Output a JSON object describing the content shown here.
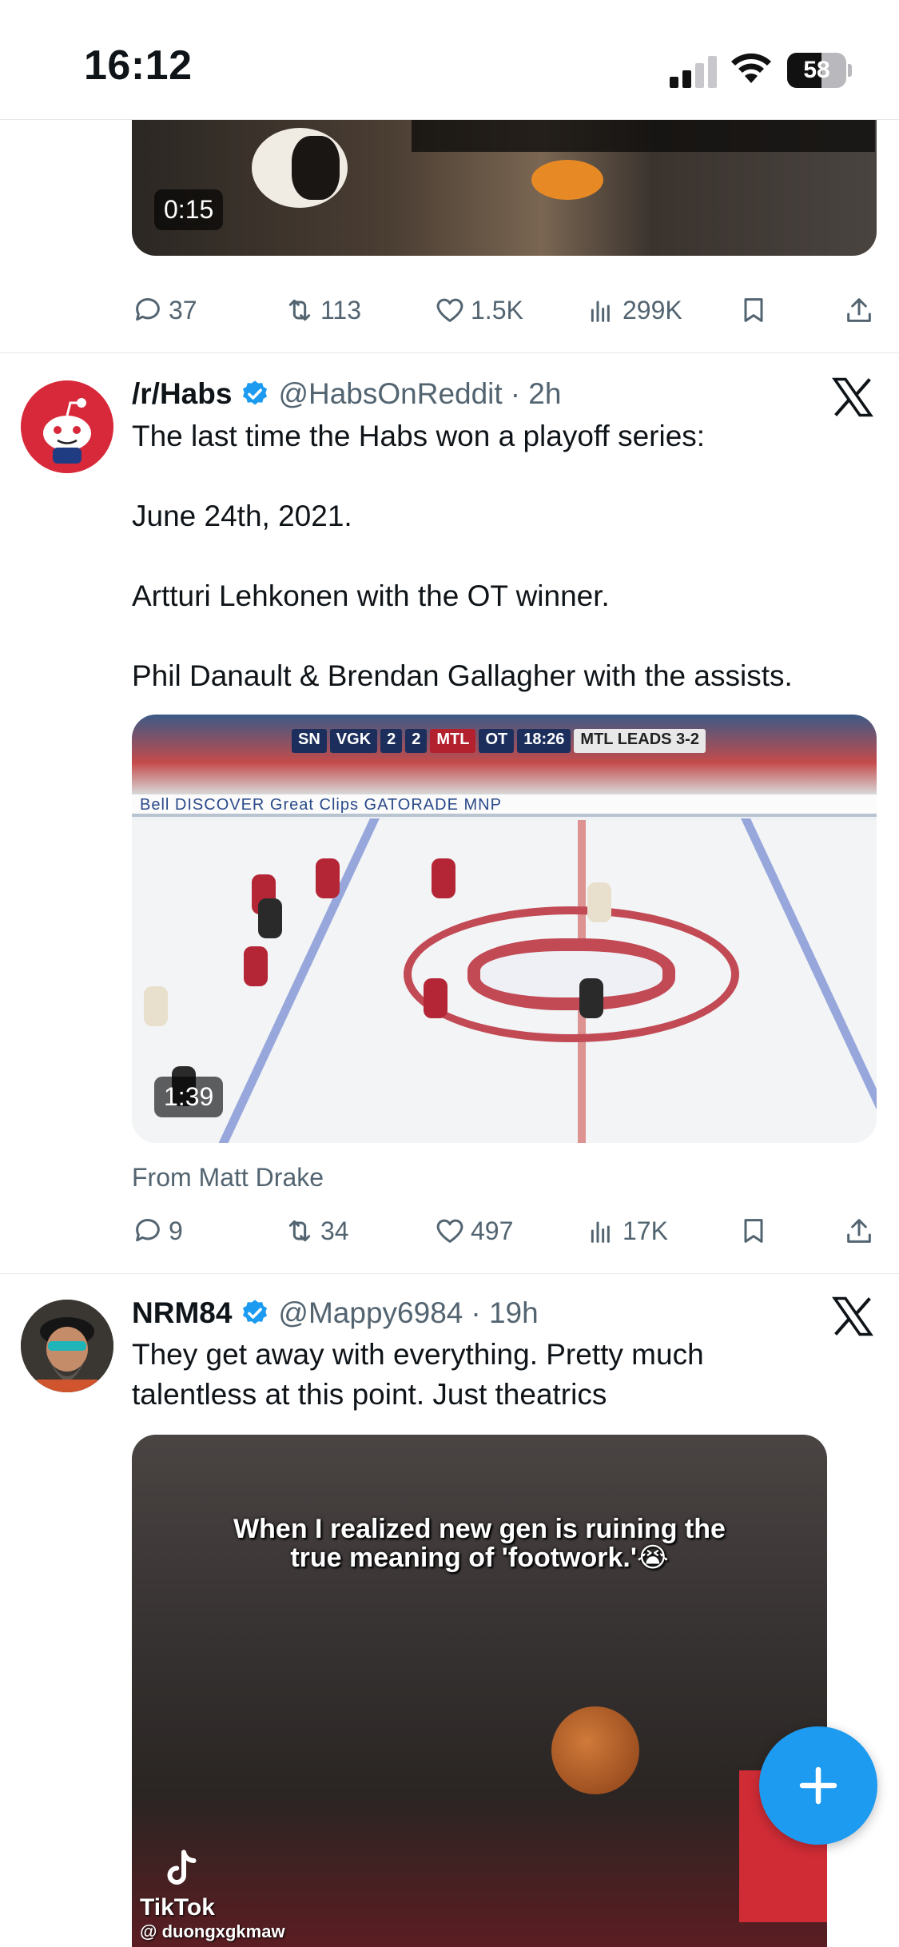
{
  "status_bar": {
    "time": "16:12",
    "battery": "58",
    "battery_level": 0.58
  },
  "tweets": [
    {
      "video_duration": "0:15",
      "stats": {
        "replies": "37",
        "reposts": "113",
        "likes": "1.5K",
        "views": "299K"
      }
    },
    {
      "display_name": "/r/Habs",
      "handle": "@HabsOnReddit",
      "time": "· 2h",
      "text": "The last time the Habs won a playoff series:\n\nJune 24th, 2021.\n\nArtturi Lehkonen with the OT winner.\n\nPhil Danault & Brendan Gallagher with the assists.",
      "video_duration": "1:39",
      "video_overlay": {
        "network": "SN",
        "team_away": "VGK",
        "score_away": "2",
        "score_home": "2",
        "team_home": "MTL",
        "period": "OT",
        "clock": "18:26",
        "series": "MTL LEADS 3-2",
        "boards": "Bell   DISCOVER   Great Clips   GATORADE   MNP"
      },
      "source": "From Matt Drake",
      "stats": {
        "replies": "9",
        "reposts": "34",
        "likes": "497",
        "views": "17K"
      }
    },
    {
      "display_name": "NRM84",
      "handle": "@Mappy6984",
      "time": "· 19h",
      "text": "They get away with everything. Pretty much\ntalentless at this point. Just theatrics",
      "video_caption": "When I realized new gen is ruining the\ntrue meaning of 'footwork.'😭",
      "watermark_brand": "TikTok",
      "watermark_user": "@ duongxgkmaw"
    }
  ],
  "colors": {
    "accent": "#1d9bf0",
    "muted": "#536471",
    "verified": "#1d9bf0"
  }
}
